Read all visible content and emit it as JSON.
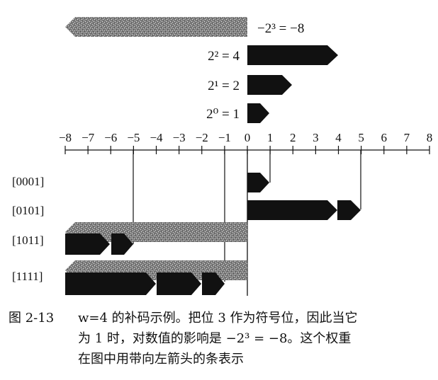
{
  "weights": {
    "neg_label": "−2³ = −8",
    "w2_label": "2² = 4",
    "w1_label": "2¹ = 2",
    "w0_label": "2⁰ = 1"
  },
  "axis": {
    "min": -8,
    "max": 8,
    "tick_labels": [
      "−8",
      "−7",
      "−6",
      "−5",
      "−4",
      "−3",
      "−2",
      "−1",
      "0",
      "1",
      "2",
      "3",
      "4",
      "5",
      "6",
      "7",
      "8"
    ]
  },
  "rows": [
    {
      "label": "[0001]",
      "value": 1
    },
    {
      "label": "[0101]",
      "value": 5
    },
    {
      "label": "[1011]",
      "value": -5
    },
    {
      "label": "[1111]",
      "value": -1
    }
  ],
  "caption": {
    "fig_number": "图 2-13",
    "line1": "w=4 的补码示例。把位 3 作为符号位，因此当它",
    "line2": "为 1 时，对数值的影响是 −2³ = −8。这个权重",
    "line3": "在图中用带向左箭头的条表示"
  },
  "colors": {
    "ink": "#111111",
    "gray_bar": "#8a8a8a"
  }
}
